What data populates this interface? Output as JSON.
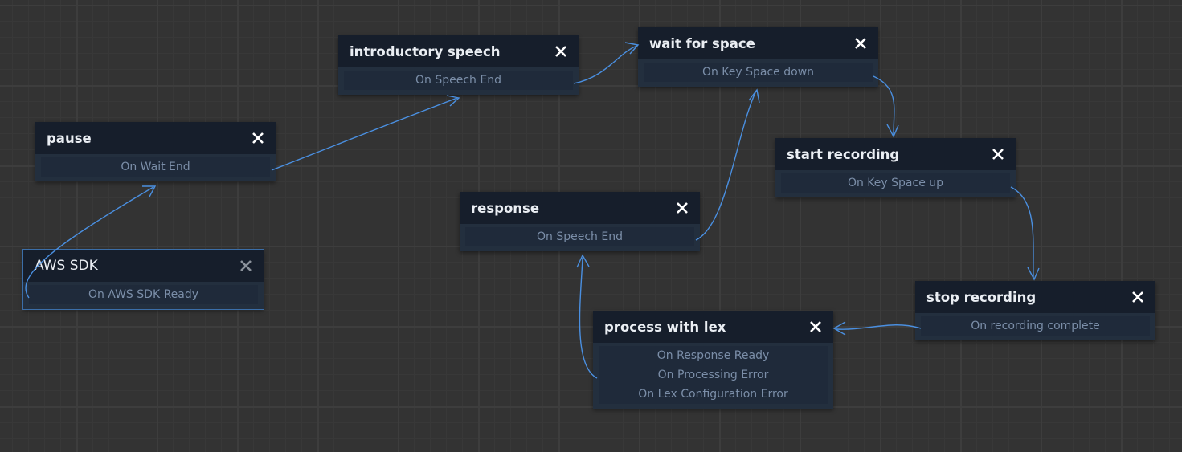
{
  "colors": {
    "wire": "#4a8fe0",
    "node_bg": "#232f3e",
    "node_header": "#161e2b",
    "event_text": "#7b8ea8"
  },
  "nodes": [
    {
      "id": "introductory-speech",
      "title": "introductory speech",
      "close_icon": "close-icon",
      "events": [
        "On Speech End"
      ]
    },
    {
      "id": "wait-for-space",
      "title": "wait for space",
      "close_icon": "close-icon",
      "events": [
        "On Key Space down"
      ]
    },
    {
      "id": "pause",
      "title": "pause",
      "close_icon": "close-icon",
      "events": [
        "On Wait End"
      ]
    },
    {
      "id": "start-recording",
      "title": "start recording",
      "close_icon": "close-icon",
      "events": [
        "On Key Space up"
      ]
    },
    {
      "id": "response",
      "title": "response",
      "close_icon": "close-icon",
      "events": [
        "On Speech End"
      ]
    },
    {
      "id": "aws-sdk",
      "title": "AWS SDK",
      "close_icon": "close-icon",
      "events": [
        "On AWS SDK Ready"
      ]
    },
    {
      "id": "stop-recording",
      "title": "stop recording",
      "close_icon": "close-icon",
      "events": [
        "On recording complete"
      ]
    },
    {
      "id": "process-with-lex",
      "title": "process with lex",
      "close_icon": "close-icon",
      "events": [
        "On Response Ready",
        "On Processing Error",
        "On Lex Configuration Error"
      ]
    }
  ]
}
